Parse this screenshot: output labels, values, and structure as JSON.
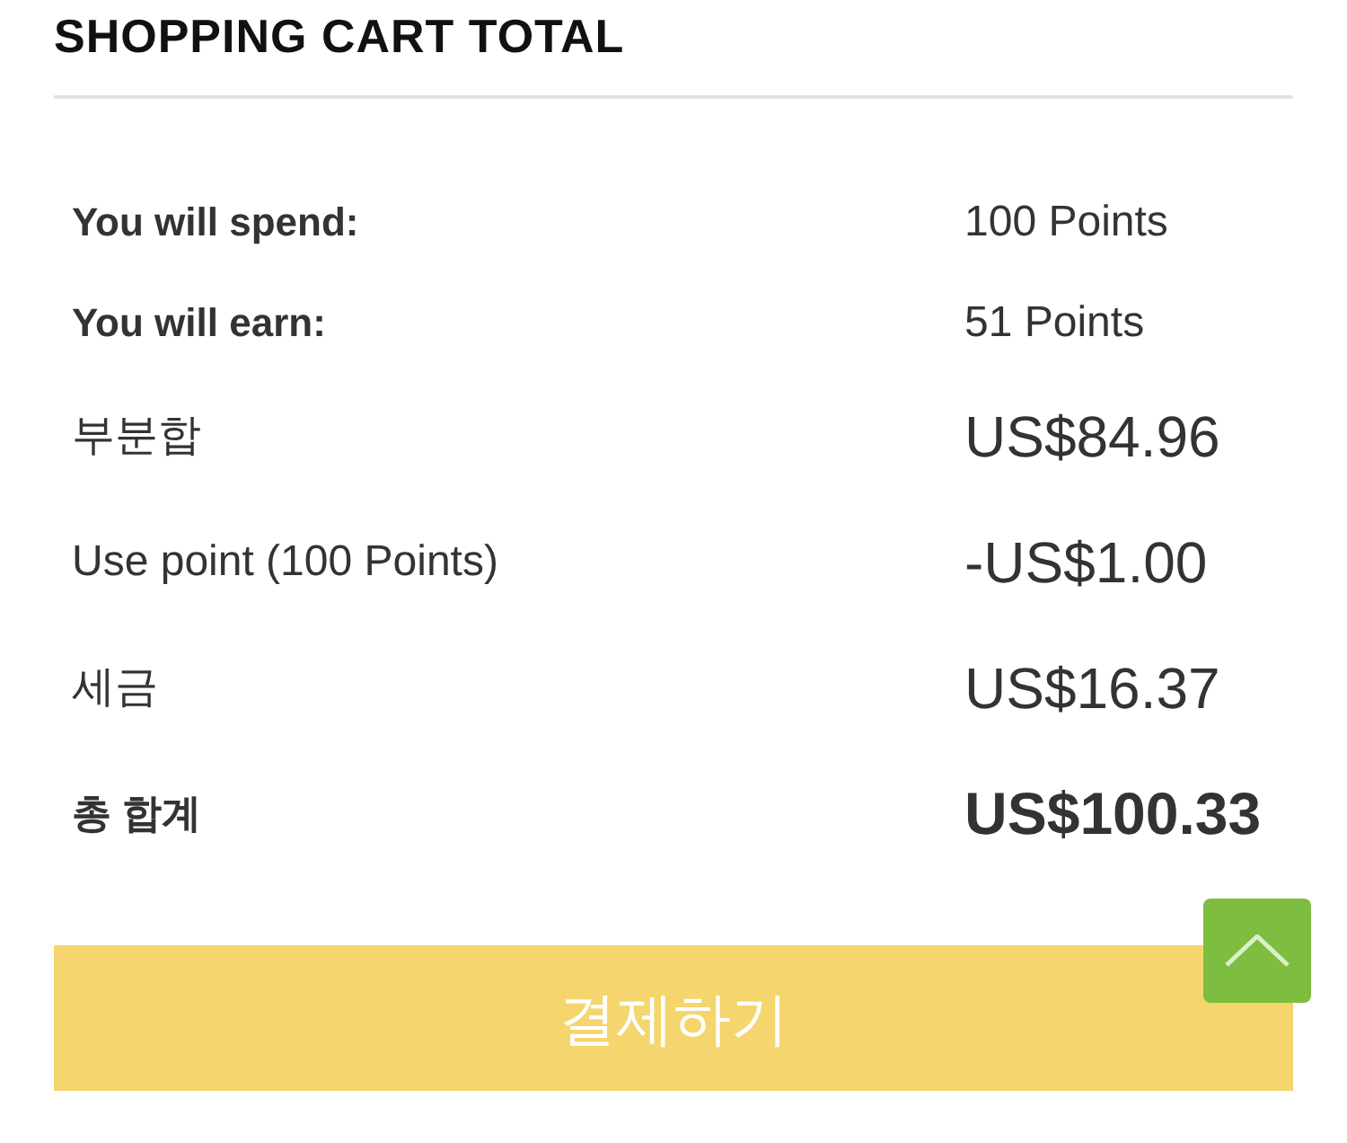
{
  "title": "SHOPPING CART TOTAL",
  "rows": [
    {
      "kind": "points",
      "label": "You will spend:",
      "value": "100 Points"
    },
    {
      "kind": "points",
      "label": "You will earn:",
      "value": "51 Points"
    },
    {
      "kind": "amount",
      "label": "부분합",
      "value": "US$84.96"
    },
    {
      "kind": "amount",
      "label": "Use point (100 Points)",
      "value": "-US$1.00"
    },
    {
      "kind": "amount",
      "label": "세금",
      "value": "US$16.37"
    },
    {
      "kind": "total",
      "label": "총 합계",
      "value": "US$100.33"
    }
  ],
  "checkout_button": {
    "label": "결제하기"
  }
}
